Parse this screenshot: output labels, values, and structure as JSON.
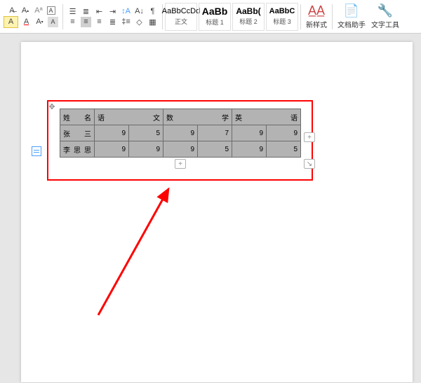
{
  "ribbon": {
    "styles": [
      {
        "preview": "AaBbCcDd",
        "label": "正文"
      },
      {
        "preview": "AaBb",
        "label": "标题 1"
      },
      {
        "preview": "AaBb(",
        "label": "标题 2"
      },
      {
        "preview": "AaBbC",
        "label": "标题 3"
      }
    ],
    "newStyle": "新样式",
    "docAssistant": "文档助手",
    "textTools": "文字工具"
  },
  "table": {
    "headers": [
      "姓名",
      "语文",
      "数学",
      "英语"
    ],
    "rows": [
      {
        "name": "张三",
        "cells": [
          "9",
          "5",
          "9",
          "7",
          "9",
          "9"
        ]
      },
      {
        "name": "李思思",
        "cells": [
          "9",
          "9",
          "9",
          "5",
          "9",
          "5"
        ]
      }
    ]
  },
  "handles": {
    "add": "+",
    "resize": "↘"
  }
}
